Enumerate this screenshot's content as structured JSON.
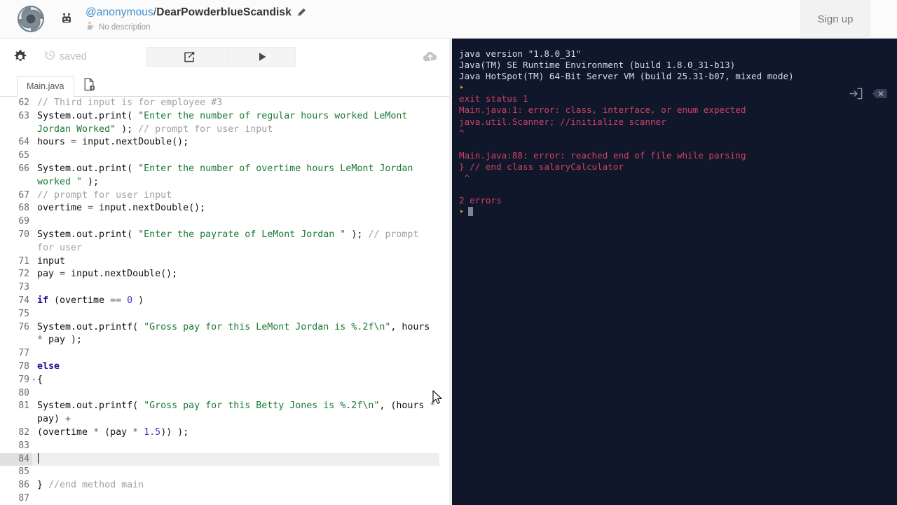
{
  "header": {
    "logo_icon": "replit-spiral-logo",
    "bot_icon": "robot-icon",
    "owner": "@anonymous",
    "separator": "/",
    "repl_name": "DearPowderblueScandisk",
    "edit_icon": "pencil-icon",
    "language_icon": "java-coffee-cup-icon",
    "description": "No description",
    "signup_label": "Sign up",
    "accent_link_color": "#3e8fd0",
    "background_color": "#fbfbfb"
  },
  "toolbar": {
    "settings_icon": "gear-icon",
    "history_icon": "history-clock-icon",
    "saved_label": "saved",
    "share_icon": "share-export-icon",
    "run_icon": "play-triangle-icon",
    "cloud_icon": "cloud-upload-icon"
  },
  "tabbar": {
    "tabs": [
      {
        "label": "Main.java",
        "active": true
      }
    ],
    "new_file_icon": "new-file-plus-icon"
  },
  "editor": {
    "first_visible_line": 62,
    "active_line": 84,
    "lines": [
      {
        "num": 62,
        "fold": false,
        "tokens": [
          {
            "t": "comment",
            "v": "// Third input is for employee #3"
          }
        ]
      },
      {
        "num": 63,
        "fold": false,
        "tokens": [
          {
            "t": "plain",
            "v": "System.out.print( "
          },
          {
            "t": "string",
            "v": "\"Enter the number of regular hours worked LeMont Jordan Worked\""
          },
          {
            "t": "plain",
            "v": " ); "
          },
          {
            "t": "comment",
            "v": "// prompt for user input"
          }
        ]
      },
      {
        "num": 64,
        "fold": false,
        "tokens": [
          {
            "t": "plain",
            "v": "hours "
          },
          {
            "t": "op",
            "v": "="
          },
          {
            "t": "plain",
            "v": " input.nextDouble();"
          }
        ]
      },
      {
        "num": 65,
        "fold": false,
        "tokens": []
      },
      {
        "num": 66,
        "fold": false,
        "tokens": [
          {
            "t": "plain",
            "v": "System.out.print( "
          },
          {
            "t": "string",
            "v": "\"Enter the number of overtime hours LeMont Jordan worked \""
          },
          {
            "t": "plain",
            "v": " );"
          }
        ]
      },
      {
        "num": 67,
        "fold": false,
        "tokens": [
          {
            "t": "comment",
            "v": "// prompt for user input"
          }
        ]
      },
      {
        "num": 68,
        "fold": false,
        "tokens": [
          {
            "t": "plain",
            "v": "overtime "
          },
          {
            "t": "op",
            "v": "="
          },
          {
            "t": "plain",
            "v": " input.nextDouble();"
          }
        ]
      },
      {
        "num": 69,
        "fold": false,
        "tokens": []
      },
      {
        "num": 70,
        "fold": false,
        "tokens": [
          {
            "t": "plain",
            "v": "System.out.print( "
          },
          {
            "t": "string",
            "v": "\"Enter the payrate of LeMont Jordan \""
          },
          {
            "t": "plain",
            "v": " ); "
          },
          {
            "t": "comment",
            "v": "// prompt for user"
          }
        ]
      },
      {
        "num": 71,
        "fold": false,
        "tokens": [
          {
            "t": "plain",
            "v": "input"
          }
        ]
      },
      {
        "num": 72,
        "fold": false,
        "tokens": [
          {
            "t": "plain",
            "v": "pay "
          },
          {
            "t": "op",
            "v": "="
          },
          {
            "t": "plain",
            "v": " input.nextDouble();"
          }
        ]
      },
      {
        "num": 73,
        "fold": false,
        "tokens": []
      },
      {
        "num": 74,
        "fold": false,
        "tokens": [
          {
            "t": "kw",
            "v": "if"
          },
          {
            "t": "plain",
            "v": " (overtime "
          },
          {
            "t": "op",
            "v": "=="
          },
          {
            "t": "plain",
            "v": " "
          },
          {
            "t": "num",
            "v": "0"
          },
          {
            "t": "plain",
            "v": " )"
          }
        ]
      },
      {
        "num": 75,
        "fold": false,
        "tokens": []
      },
      {
        "num": 76,
        "fold": false,
        "tokens": [
          {
            "t": "plain",
            "v": "System.out.printf( "
          },
          {
            "t": "string",
            "v": "\"Gross pay for this LeMont Jordan is %.2f\\n\""
          },
          {
            "t": "plain",
            "v": ", hours "
          },
          {
            "t": "op",
            "v": "*"
          },
          {
            "t": "plain",
            "v": " pay );"
          }
        ]
      },
      {
        "num": 77,
        "fold": false,
        "tokens": []
      },
      {
        "num": 78,
        "fold": false,
        "tokens": [
          {
            "t": "kw",
            "v": "else"
          }
        ]
      },
      {
        "num": 79,
        "fold": true,
        "tokens": [
          {
            "t": "plain",
            "v": "{"
          }
        ]
      },
      {
        "num": 80,
        "fold": false,
        "tokens": []
      },
      {
        "num": 81,
        "fold": false,
        "tokens": [
          {
            "t": "plain",
            "v": "System.out.printf( "
          },
          {
            "t": "string",
            "v": "\"Gross pay for this Betty Jones is %.2f\\n\""
          },
          {
            "t": "plain",
            "v": ", (hours "
          },
          {
            "t": "op",
            "v": "*"
          },
          {
            "t": "plain",
            "v": " pay) "
          },
          {
            "t": "op",
            "v": "+"
          }
        ]
      },
      {
        "num": 82,
        "fold": false,
        "tokens": [
          {
            "t": "plain",
            "v": "(overtime "
          },
          {
            "t": "op",
            "v": "*"
          },
          {
            "t": "plain",
            "v": " (pay "
          },
          {
            "t": "op",
            "v": "*"
          },
          {
            "t": "plain",
            "v": " "
          },
          {
            "t": "num",
            "v": "1.5"
          },
          {
            "t": "plain",
            "v": ")) );"
          }
        ]
      },
      {
        "num": 83,
        "fold": false,
        "tokens": []
      },
      {
        "num": 84,
        "fold": false,
        "tokens": [],
        "caret": true
      },
      {
        "num": 85,
        "fold": false,
        "tokens": []
      },
      {
        "num": 86,
        "fold": false,
        "tokens": [
          {
            "t": "plain",
            "v": "} "
          },
          {
            "t": "comment",
            "v": "//end method main"
          }
        ]
      },
      {
        "num": 87,
        "fold": false,
        "tokens": []
      }
    ]
  },
  "console": {
    "background_color": "#10172a",
    "enter_icon": "enter-input-icon",
    "clear_icon": "backspace-clear-icon",
    "lines": [
      {
        "style": "white",
        "text": "java version \"1.8.0_31\""
      },
      {
        "style": "white",
        "text": "Java(TM) SE Runtime Environment (build 1.8.0_31-b13)"
      },
      {
        "style": "white",
        "text": "Java HotSpot(TM) 64-Bit Server VM (build 25.31-b07, mixed mode)"
      },
      {
        "style": "prompt",
        "text": "‣"
      },
      {
        "style": "error",
        "text": "exit status 1"
      },
      {
        "style": "error",
        "text": "Main.java:1: error: class, interface, or enum expected"
      },
      {
        "style": "error",
        "text": "java.util.Scanner; //initialize scanner"
      },
      {
        "style": "error",
        "text": "^"
      },
      {
        "style": "error",
        "text": ""
      },
      {
        "style": "error",
        "text": "Main.java:88: error: reached end of file while parsing"
      },
      {
        "style": "error",
        "text": "} // end class salaryCalculator"
      },
      {
        "style": "error",
        "text": " ^"
      },
      {
        "style": "error",
        "text": ""
      },
      {
        "style": "error",
        "text": "2 errors"
      }
    ],
    "final_prompt": "‣",
    "has_cursor": true
  }
}
